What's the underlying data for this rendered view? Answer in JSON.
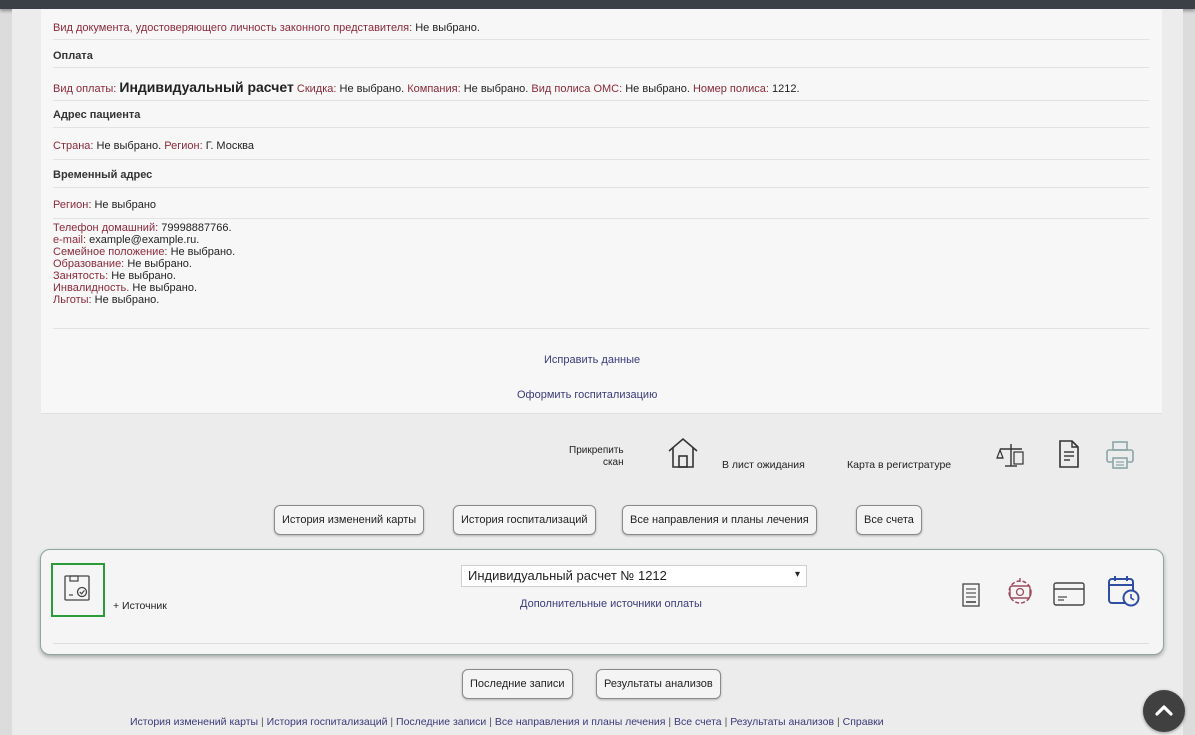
{
  "info": {
    "legal_rep_doc": {
      "label": "Вид документа, удостоверяющего личность законного представителя:",
      "value": "Не выбрано."
    },
    "payment_heading": "Оплата",
    "payment": {
      "type_label": "Вид оплаты:",
      "type_value": "Индивидуальный расчет",
      "discount_label": "Скидка:",
      "discount_value": "Не выбрано.",
      "company_label": "Компания:",
      "company_value": "Не выбрано.",
      "policy_type_label": "Вид полиса ОМС:",
      "policy_type_value": "Не выбрано.",
      "policy_number_label": "Номер полиса:",
      "policy_number_value": "1212."
    },
    "address_heading": "Адрес пациента",
    "address": {
      "country_label": "Страна:",
      "country_value": "Не выбрано.",
      "region_label": "Регион:",
      "region_value": "Г. Москва"
    },
    "temp_address_heading": "Временный адрес",
    "temp_address": {
      "region_label": "Регион:",
      "region_value": "Не выбрано"
    },
    "details": [
      {
        "label": "Телефон домашний:",
        "value": "79998887766."
      },
      {
        "label": "e-mail:",
        "value": "example@example.ru."
      },
      {
        "label": "Семейное положение:",
        "value": "Не выбрано."
      },
      {
        "label": "Образование:",
        "value": "Не выбрано."
      },
      {
        "label": "Занятость:",
        "value": "Не выбрано."
      },
      {
        "label": "Инвалидность.",
        "value": "Не выбрано."
      },
      {
        "label": "Льготы:",
        "value": "Не выбрано."
      }
    ],
    "edit_link": "Исправить данные",
    "hospitalize_link": "Оформить госпитализацию"
  },
  "tools": {
    "attach_scan_line1": "Прикрепить",
    "attach_scan_line2": "скан",
    "waitlist": "В лист ожидания",
    "registry_card": "Карта в регистратуре"
  },
  "buttons": {
    "card_history": "История изменений карты",
    "hosp_history": "История госпитализаций",
    "all_directions": "Все направления и планы лечения",
    "all_bills": "Все счета",
    "last_records": "Последние записи",
    "analysis_results": "Результаты анализов"
  },
  "payment_source": {
    "add_source": "+ Источник",
    "selected": "Индивидуальный расчет № 1212",
    "extra_sources": "Дополнительные источники оплаты"
  },
  "footer": {
    "links": [
      "История изменений карты",
      "История госпитализаций",
      "Последние записи",
      "Все направления и планы лечения",
      "Все счета",
      "Результаты анализов",
      "Справки"
    ]
  },
  "colors": {
    "label": "#8a2a3a",
    "link": "#3a3a7a",
    "accent_green": "#2a9a3a"
  }
}
